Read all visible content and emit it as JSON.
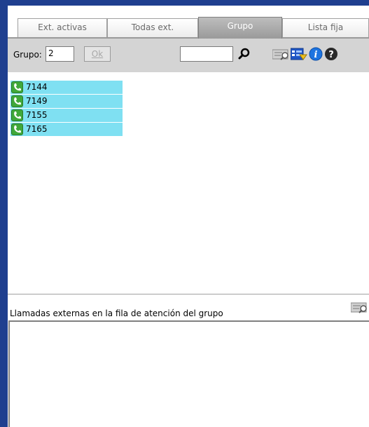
{
  "tabs": [
    {
      "label": "Ext. activas",
      "active": false
    },
    {
      "label": "Todas ext.",
      "active": false
    },
    {
      "label": "Grupo",
      "active": true
    },
    {
      "label": "Lista fija",
      "active": false
    }
  ],
  "toolbar": {
    "group_label": "Grupo:",
    "group_value": "2",
    "ok_label": "Ok",
    "search_value": "",
    "icons": [
      "search-icon",
      "search-list-icon",
      "view-options-icon",
      "info-icon",
      "help-icon"
    ]
  },
  "extensions": [
    {
      "number": "7144"
    },
    {
      "number": "7149"
    },
    {
      "number": "7155"
    },
    {
      "number": "7165"
    }
  ],
  "queue": {
    "title": "Llamadas externas en la fila de atención del grupo"
  },
  "colors": {
    "frame": "#1f3f8f",
    "extension_row": "#7fe0f2",
    "phone_icon": "#3fa83a",
    "toolbar_bg": "#d4d4d4"
  }
}
